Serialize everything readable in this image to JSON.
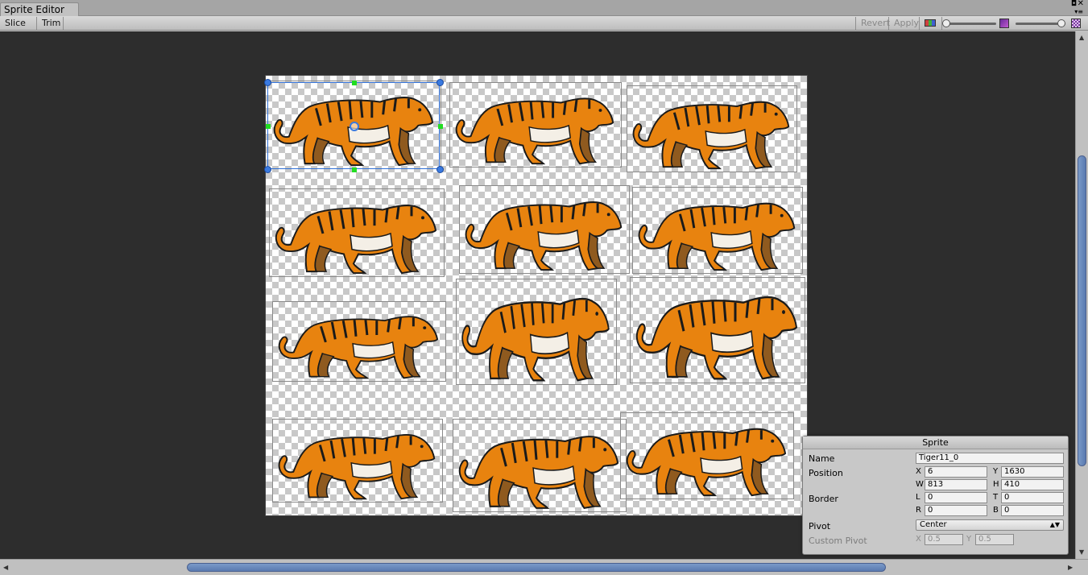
{
  "window": {
    "tab_title": "Sprite Editor",
    "tab_close_glyph": "✕",
    "tab_max_glyph": "◘",
    "tab_menu_glyph": "▾≡"
  },
  "toolbar": {
    "slice_label": "Slice ÷",
    "trim_label": "Trim",
    "revert_label": "Revert",
    "apply_label": "Apply",
    "zoom_level": 0.0,
    "mip_level": 1.0
  },
  "canvas": {
    "background_color": "#2d2d2d",
    "sprite_count": 12,
    "selected_sprite": "Tiger11_0"
  },
  "inspector": {
    "title": "Sprite",
    "name_label": "Name",
    "name_value": "Tiger11_0",
    "position_label": "Position",
    "x_label": "X",
    "x_value": "6",
    "y_label": "Y",
    "y_value": "1630",
    "w_label": "W",
    "w_value": "813",
    "h_label": "H",
    "h_value": "410",
    "border_label": "Border",
    "l_label": "L",
    "l_value": "0",
    "t_label": "T",
    "t_value": "0",
    "r_label": "R",
    "r_value": "0",
    "b_label": "B",
    "b_value": "0",
    "pivot_label": "Pivot",
    "pivot_value": "Center",
    "custom_pivot_label": "Custom Pivot",
    "cp_x_label": "X",
    "cp_x_value": "0.5",
    "cp_y_label": "Y",
    "cp_y_value": "0.5"
  },
  "scrollbars": {
    "up_arrow": "▲",
    "down_arrow": "▼",
    "left_arrow": "◀",
    "right_arrow": "▶"
  }
}
